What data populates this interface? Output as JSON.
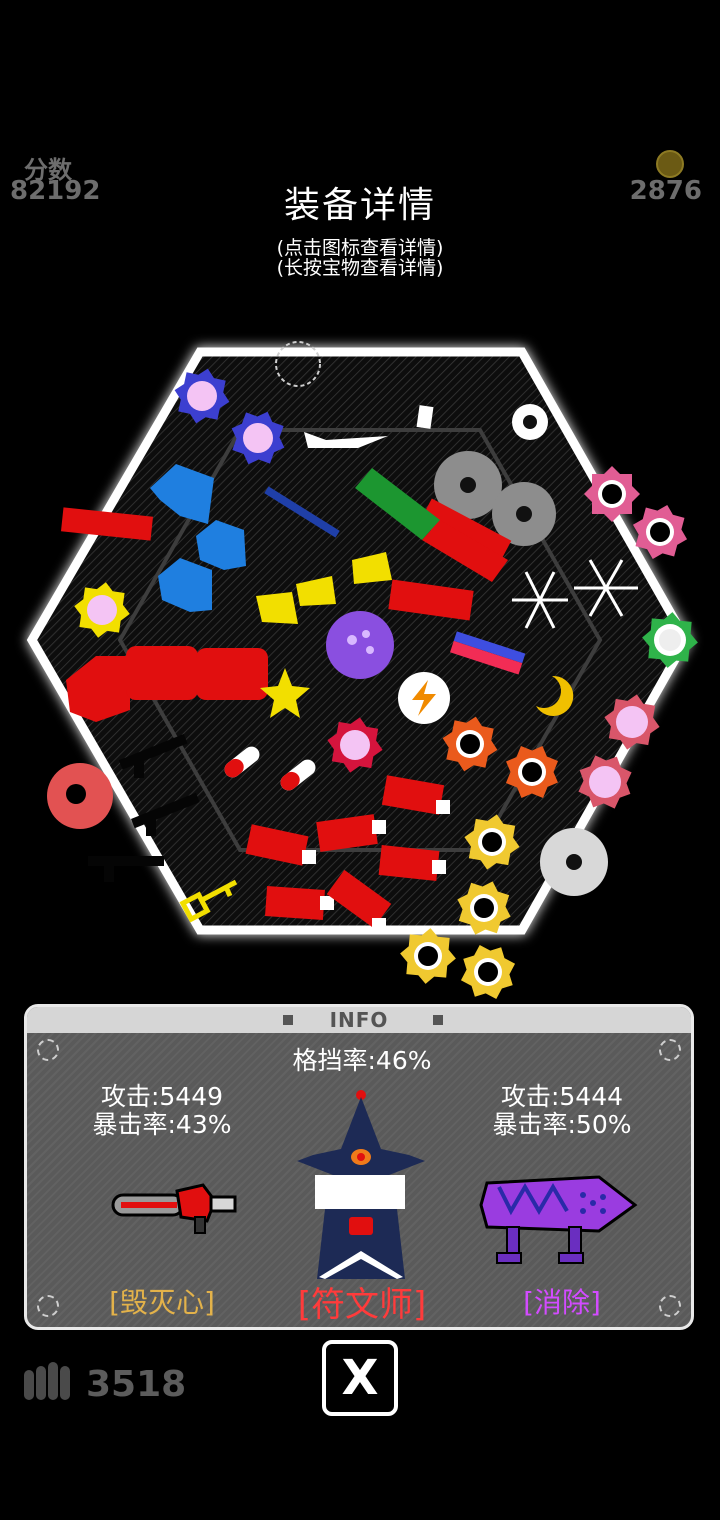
{
  "background": {
    "score_label": "分数",
    "score_value": "82192",
    "coins_value": "2876",
    "ammo_value": "3518"
  },
  "header": {
    "title": "装备详情",
    "hint_tap": "(点击图标查看详情)",
    "hint_hold": "(长按宝物查看详情)"
  },
  "info_panel": {
    "title": "INFO",
    "block_rate": "格挡率:46%",
    "left_weapon": {
      "attack": "攻击:5449",
      "crit": "暴击率:43%",
      "name": "[毁灭心]",
      "name_color": "#e3b24a"
    },
    "center_hero": {
      "name": "[符文师]",
      "name_color": "#ff3b3b"
    },
    "right_weapon": {
      "attack": "攻击:5444",
      "crit": "暴击率:50%",
      "name": "[消除]",
      "name_color": "#d24bff"
    }
  },
  "close_button": {
    "label": "X"
  },
  "colors": {
    "hex_glow": "#ffffff",
    "item_red": "#e10f0f",
    "item_blue": "#1f7fe0",
    "item_yellow": "#f2df00"
  }
}
